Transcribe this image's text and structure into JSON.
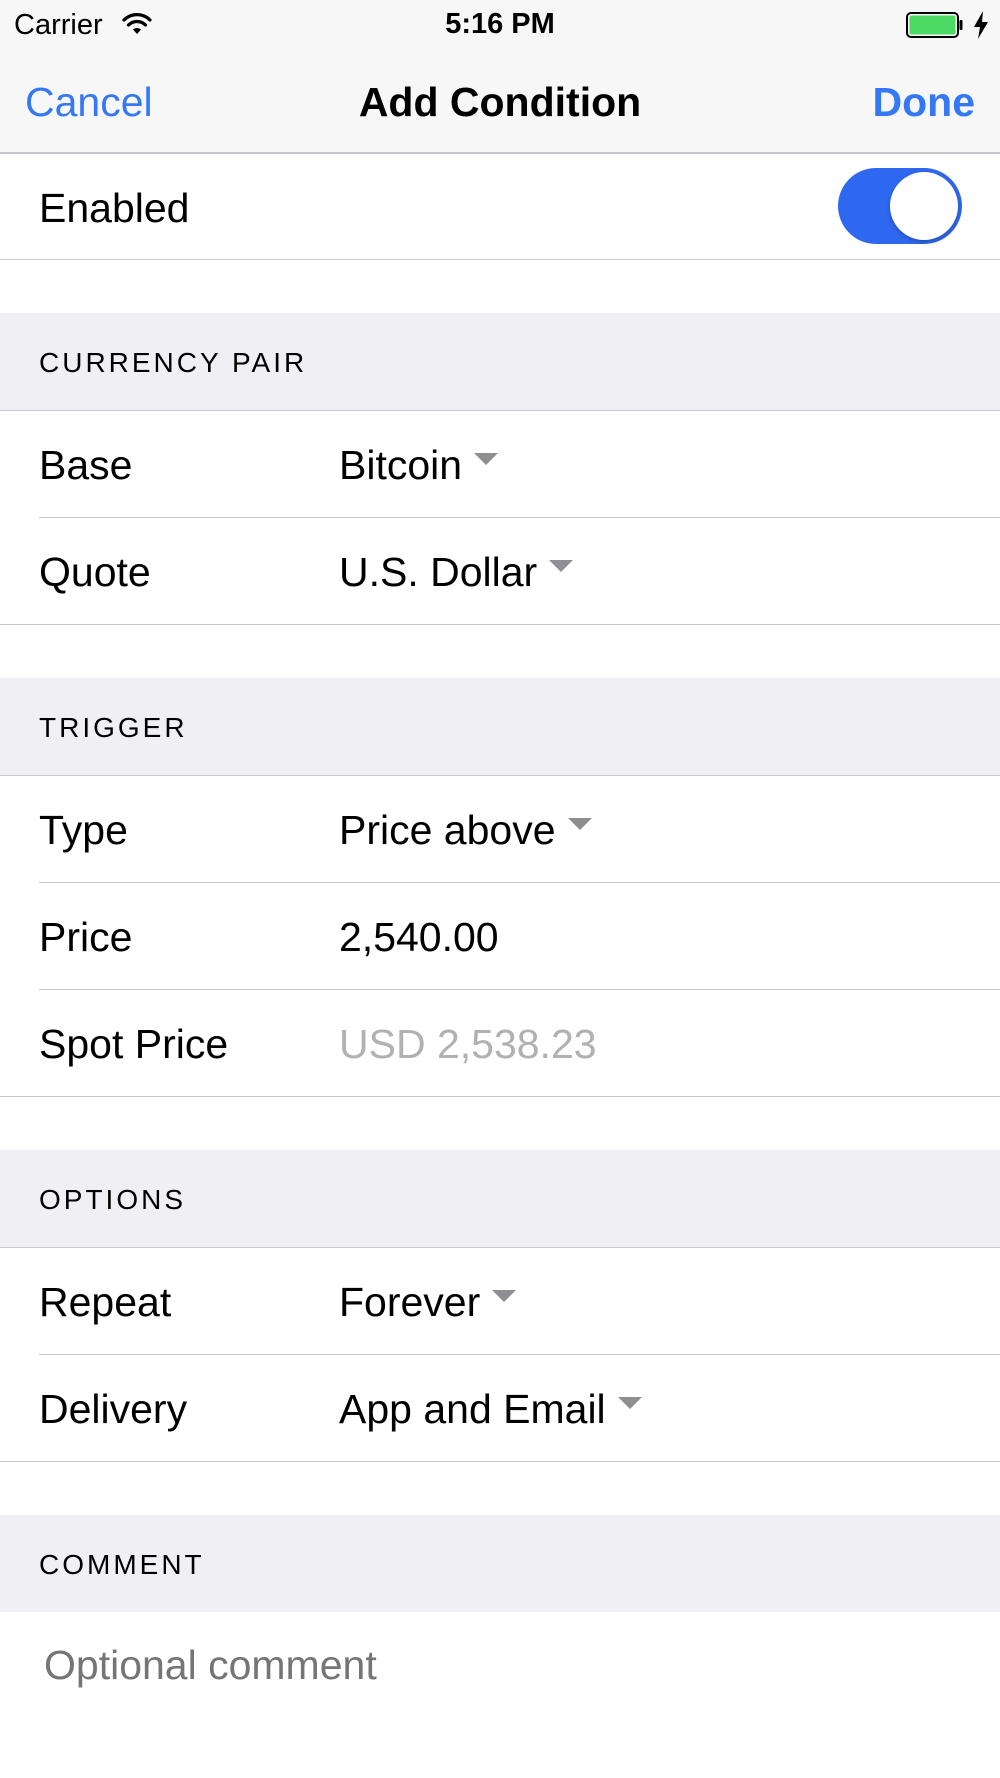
{
  "status_bar": {
    "carrier": "Carrier",
    "time": "5:16 PM",
    "battery_color": "#4cd964",
    "icons": [
      "wifi-icon",
      "battery-icon",
      "charging-bolt-icon"
    ]
  },
  "nav": {
    "cancel_label": "Cancel",
    "title": "Add Condition",
    "done_label": "Done",
    "accent_color": "#3478f6"
  },
  "enabled": {
    "label": "Enabled",
    "on": true,
    "toggle_color": "#2f68f0"
  },
  "currency_pair": {
    "header": "CURRENCY PAIR",
    "base": {
      "label": "Base",
      "value": "Bitcoin"
    },
    "quote": {
      "label": "Quote",
      "value": "U.S. Dollar"
    }
  },
  "trigger": {
    "header": "TRIGGER",
    "type": {
      "label": "Type",
      "value": "Price above"
    },
    "price": {
      "label": "Price",
      "value": "2,540.00"
    },
    "spot_price": {
      "label": "Spot Price",
      "value": "USD 2,538.23"
    }
  },
  "options": {
    "header": "OPTIONS",
    "repeat": {
      "label": "Repeat",
      "value": "Forever"
    },
    "delivery": {
      "label": "Delivery",
      "value": "App and Email"
    }
  },
  "comment": {
    "header": "COMMENT",
    "placeholder": "Optional comment"
  }
}
